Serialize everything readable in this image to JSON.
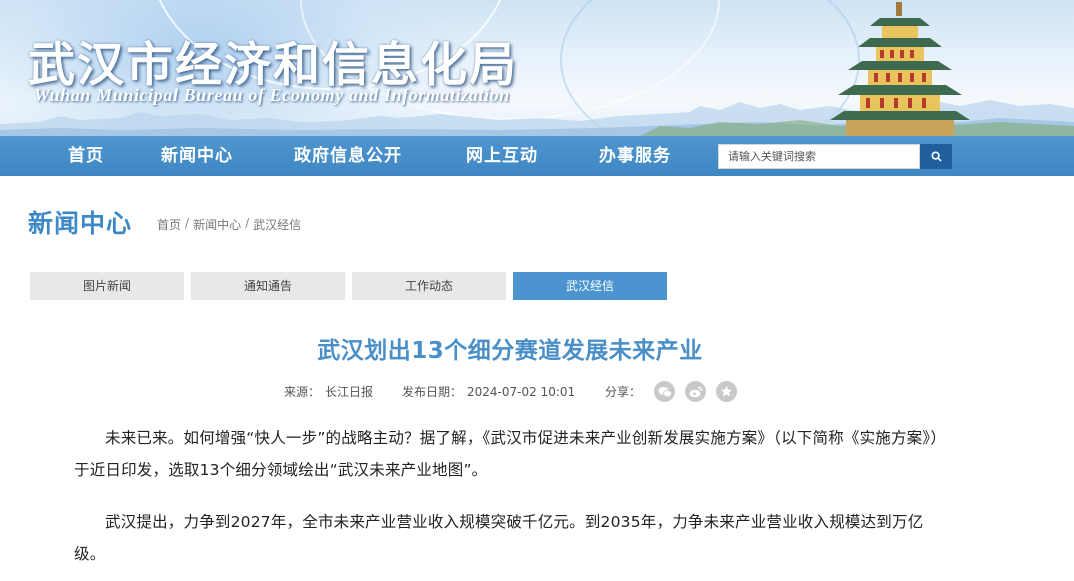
{
  "header": {
    "title": "武汉市经济和信息化局",
    "subtitle": "Wuhan Municipal Bureau of Economy and Informatization"
  },
  "nav": {
    "items": [
      {
        "label": "首页"
      },
      {
        "label": "新闻中心"
      },
      {
        "label": "政府信息公开"
      },
      {
        "label": "网上互动"
      },
      {
        "label": "办事服务"
      }
    ],
    "search_placeholder": "请输入关键词搜索",
    "search_icon": "search-icon"
  },
  "section": {
    "title": "新闻中心",
    "breadcrumb": [
      "首页",
      "新闻中心",
      "武汉经信"
    ],
    "separator": "/"
  },
  "tabs": [
    {
      "label": "图片新闻",
      "active": false
    },
    {
      "label": "通知通告",
      "active": false
    },
    {
      "label": "工作动态",
      "active": false
    },
    {
      "label": "武汉经信",
      "active": true
    }
  ],
  "article": {
    "title": "武汉划出13个细分赛道发展未来产业",
    "source_label": "来源：",
    "source": "长江日报",
    "date_label": "发布日期：",
    "date": "2024-07-02 10:01",
    "share_label": "分享：",
    "share_icons": [
      "wechat-icon",
      "weibo-icon",
      "favorite-icon"
    ],
    "paragraphs": [
      "未来已来。如何增强“快人一步”的战略主动？据了解，《武汉市促进未来产业创新发展实施方案》（以下简称《实施方案》）于近日印发，选取13个细分领域绘出“武汉未来产业地图”。",
      "武汉提出，力争到2027年，全市未来产业营业收入规模突破千亿元。到2035年，力争未来产业营业收入规模达到万亿级。"
    ]
  },
  "colors": {
    "nav_bg": "#4590cb",
    "accent": "#3d89c8",
    "tab_active": "#4b94d0",
    "tab_inactive": "#e8e8e8",
    "search_button": "#1f5f9c"
  }
}
